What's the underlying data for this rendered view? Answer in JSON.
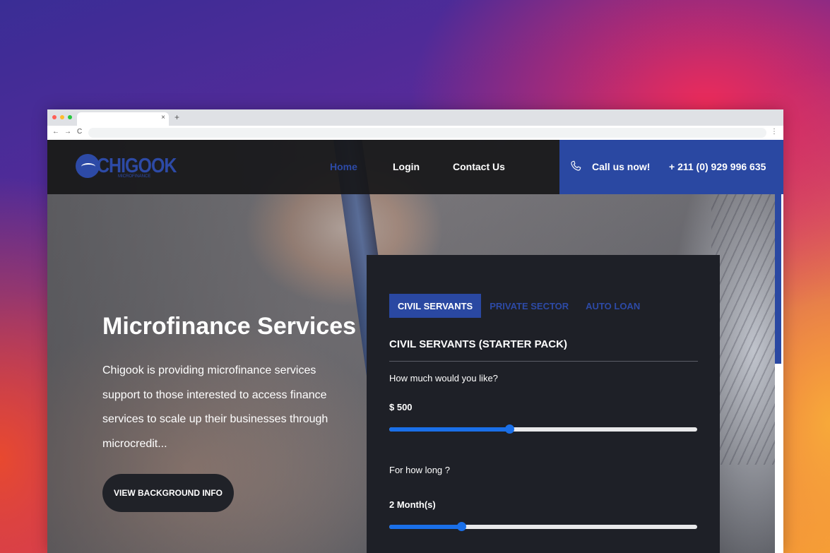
{
  "browser": {
    "tab_close": "×",
    "new_tab": "+",
    "back": "←",
    "forward": "→",
    "reload": "C",
    "menu": "⋮",
    "dot_colors": [
      "#ff5f57",
      "#febc2e",
      "#28c840"
    ]
  },
  "header": {
    "logo_text": "CHIGOOK",
    "logo_sub": "MICROFINANCE",
    "nav": [
      {
        "label": "Home",
        "active": true
      },
      {
        "label": "Login",
        "active": false
      },
      {
        "label": "Contact Us",
        "active": false
      }
    ],
    "call_label": "Call us now!",
    "call_number": "+ 211 (0) 929 996 635",
    "icons": {
      "phone": "phone-icon"
    }
  },
  "hero": {
    "title": "Microfinance Services",
    "text": "Chigook is providing microfinance services support to those interested to access finance services to scale up their businesses through microcredit...",
    "button": "VIEW BACKGROUND INFO"
  },
  "calculator": {
    "tabs": [
      {
        "label": "CIVIL SERVANTS",
        "active": true
      },
      {
        "label": "PRIVATE SECTOR",
        "active": false
      },
      {
        "label": "AUTO LOAN",
        "active": false
      }
    ],
    "heading": "CIVIL SERVANTS (STARTER PACK)",
    "amount_question": "How much would you like?",
    "amount_value": "$ 500",
    "amount_level": 0.39,
    "duration_question": "For how long ?",
    "duration_value": "2 Month(s)",
    "duration_level": 0.235
  },
  "colors": {
    "brand_blue": "#2a48a2",
    "slider_blue": "#1a6fe8",
    "panel_bg": "#1e2027",
    "header_bg": "#171719"
  }
}
